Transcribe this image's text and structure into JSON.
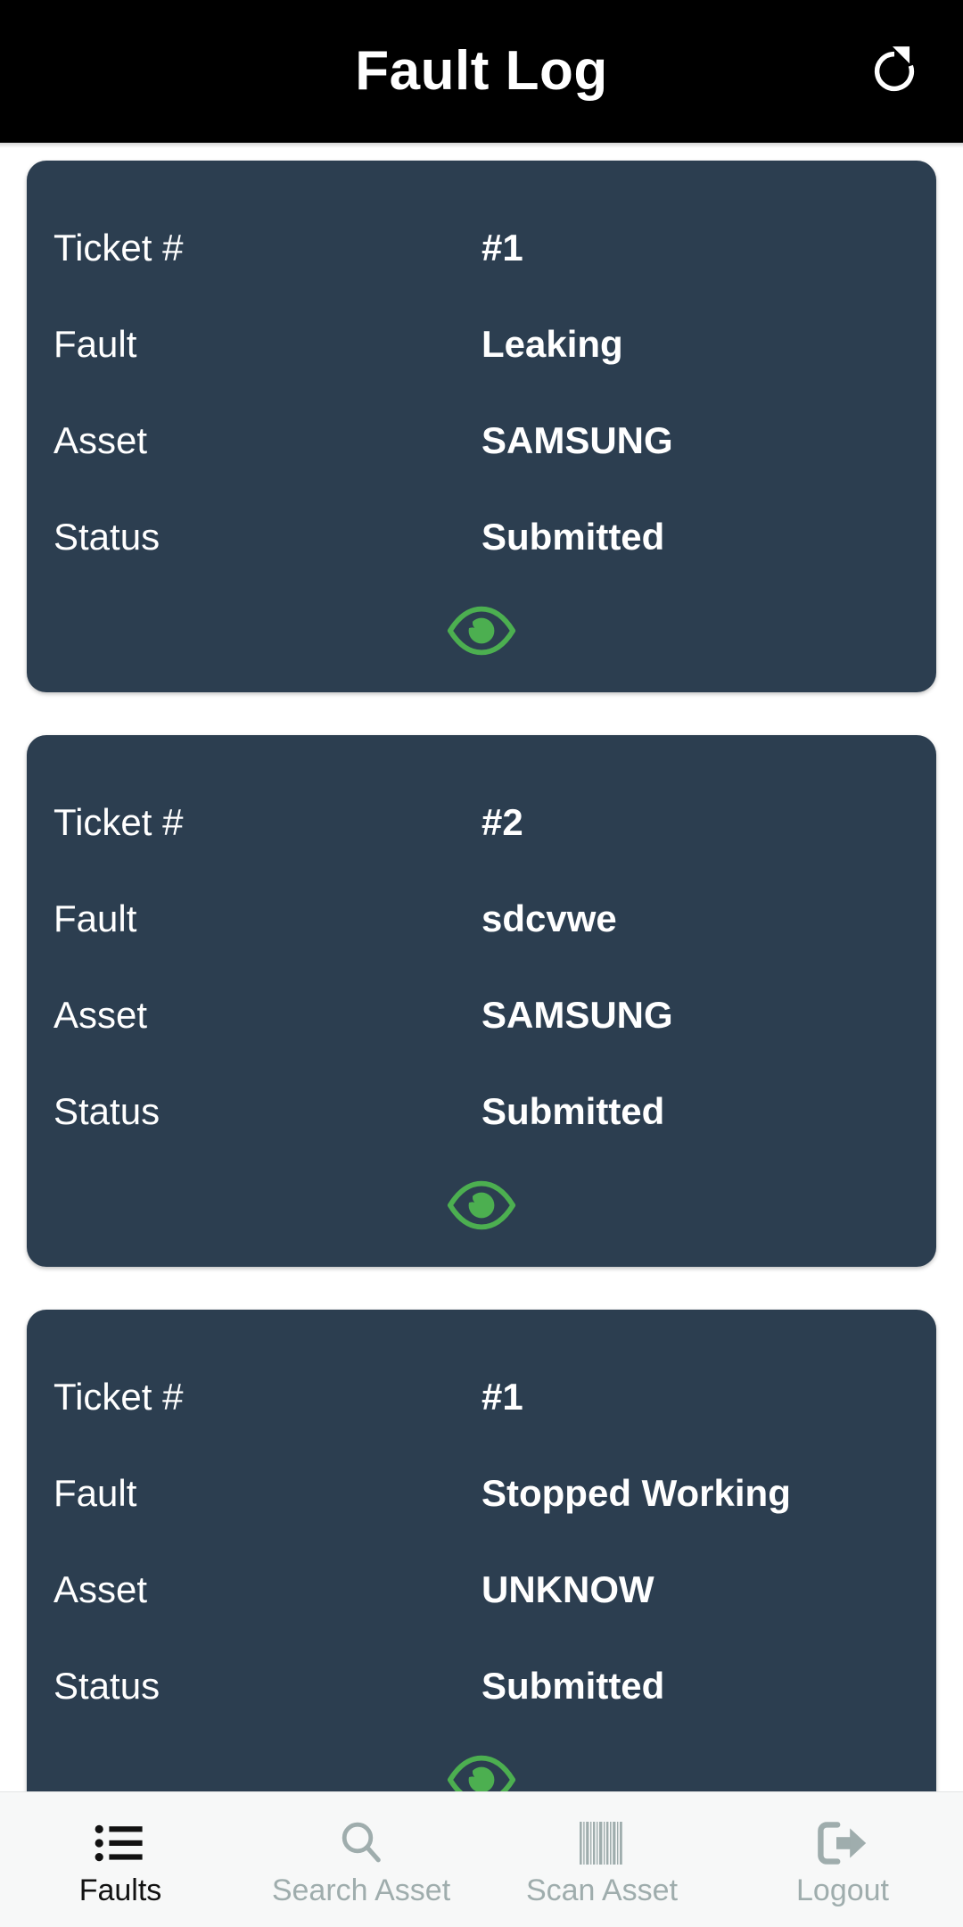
{
  "header": {
    "title": "Fault Log",
    "refresh_icon": "refresh-icon",
    "background_color": "#000000",
    "text_color": "#ffffff"
  },
  "theme": {
    "card_background": "#2c3e50",
    "page_background": "#ffffff",
    "accent_green": "#4caf50",
    "nav_active_color": "#121212",
    "nav_inactive_color": "#9fadad",
    "nav_background": "#f7f8f8"
  },
  "labels": {
    "ticket": "Ticket #",
    "fault": "Fault",
    "asset": "Asset",
    "status": "Status",
    "view_icon": "eye-icon"
  },
  "faults": [
    {
      "ticket": "#1",
      "fault": "Leaking",
      "asset": "SAMSUNG",
      "status": "Submitted"
    },
    {
      "ticket": "#2",
      "fault": "sdcvwe",
      "asset": "SAMSUNG",
      "status": "Submitted"
    },
    {
      "ticket": "#1",
      "fault": "Stopped Working",
      "asset": "UNKNOW",
      "status": "Submitted"
    }
  ],
  "bottom_nav": {
    "items": [
      {
        "label": "Faults",
        "icon": "list-icon",
        "active": true
      },
      {
        "label": "Search Asset",
        "icon": "search-icon",
        "active": false
      },
      {
        "label": "Scan Asset",
        "icon": "barcode-icon",
        "active": false
      },
      {
        "label": "Logout",
        "icon": "logout-icon",
        "active": false
      }
    ]
  }
}
